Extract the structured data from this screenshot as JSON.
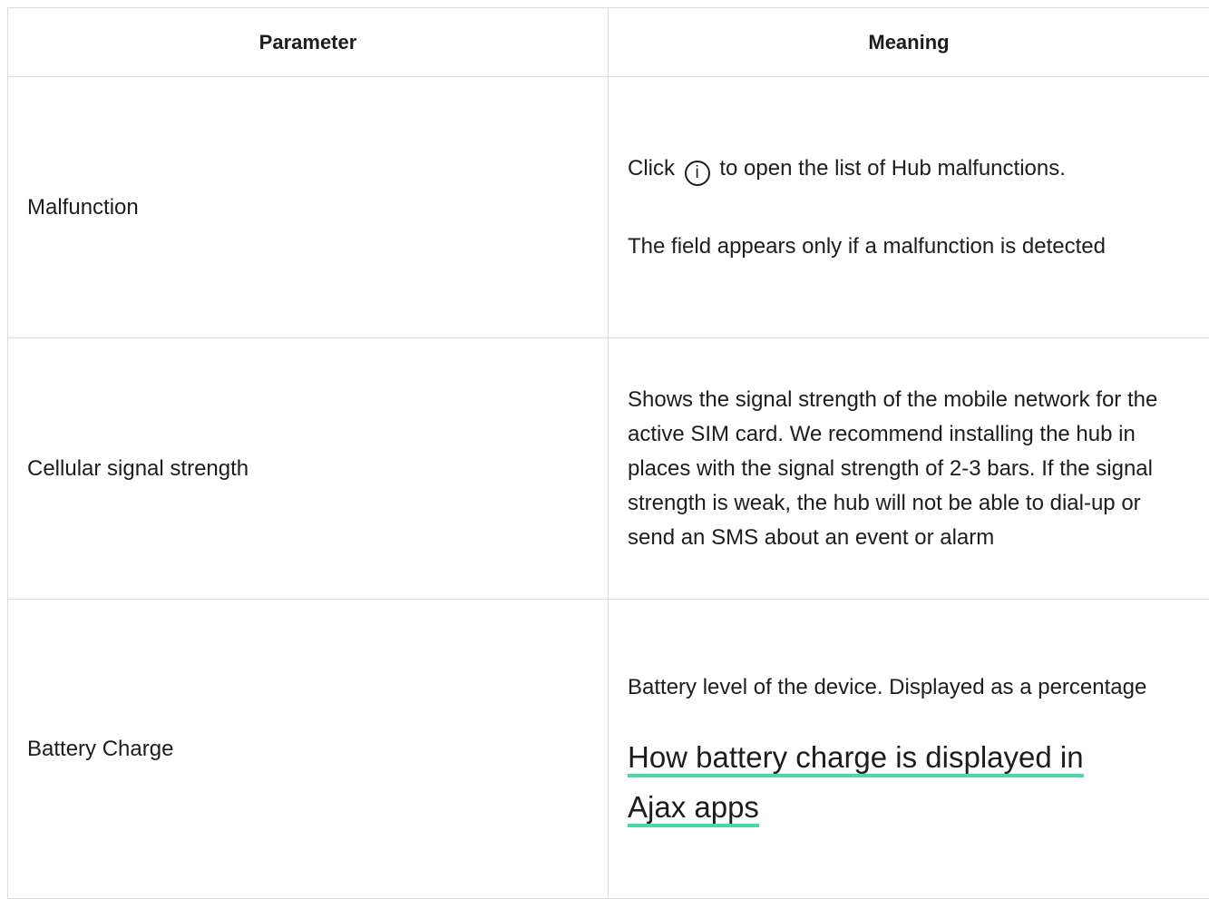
{
  "table": {
    "headers": {
      "parameter": "Parameter",
      "meaning": "Meaning"
    },
    "rows": [
      {
        "parameter": "Malfunction",
        "meaning_prefix": "Click",
        "meaning_icon": "i",
        "meaning_suffix": "to open the list of Hub malfunctions.",
        "meaning_note": "The field appears only if a malfunction is detected"
      },
      {
        "parameter": "Cellular signal strength",
        "meaning": "Shows the signal strength of the mobile network for the active SIM card. We recommend installing the hub in places with the signal strength of 2-3 bars. If the signal strength is weak, the hub will not be able to dial-up or send an SMS about an event or alarm"
      },
      {
        "parameter": "Battery Charge",
        "meaning": "Battery level of the device. Displayed as a percentage",
        "link_text": "How battery charge is displayed in Ajax apps"
      }
    ]
  },
  "colors": {
    "link_underline": "#4ad7a9",
    "border": "#dcdcdc",
    "text": "#1d1d1f"
  },
  "icons": {
    "info": "info-circle-icon"
  }
}
